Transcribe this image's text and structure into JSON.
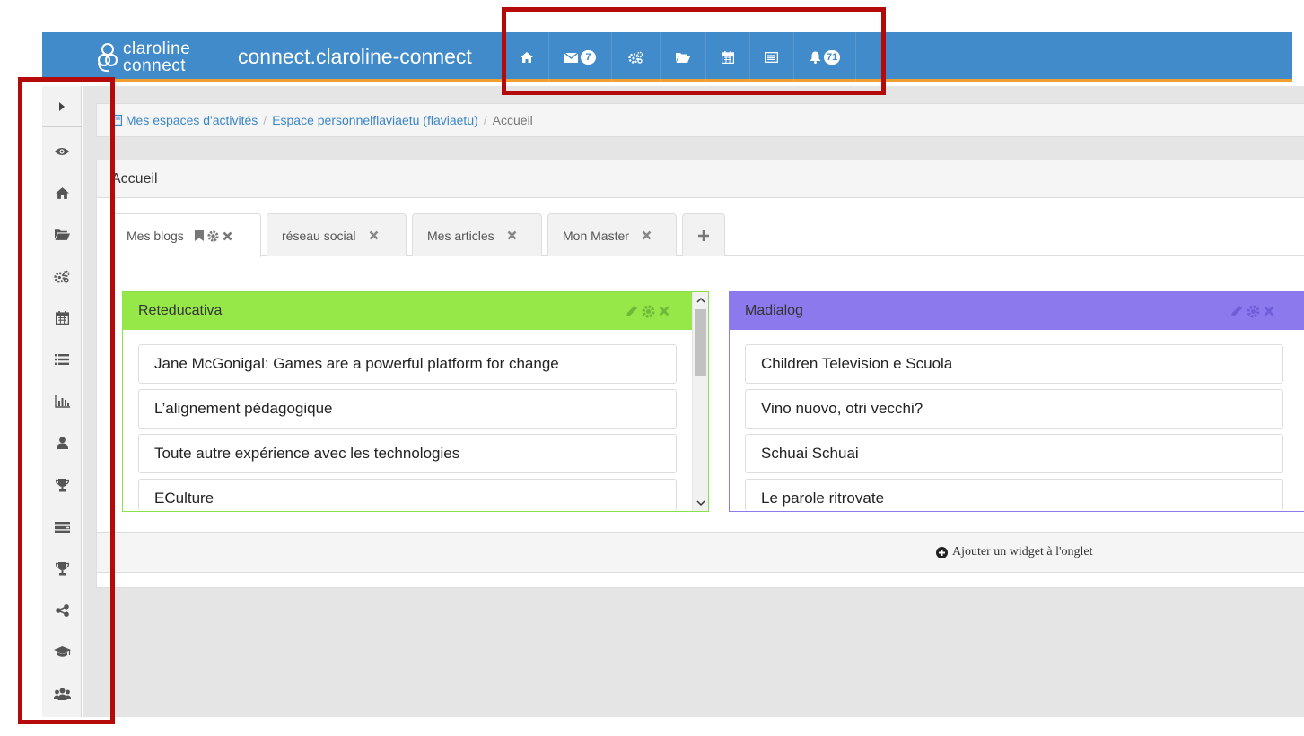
{
  "brand": {
    "logo_line1": "claroline",
    "logo_line2": "connect",
    "site_title": "connect.claroline-connect"
  },
  "topnav": [
    {
      "name": "home",
      "icon": "home-icon"
    },
    {
      "name": "messages",
      "icon": "envelope-icon",
      "badge": "7"
    },
    {
      "name": "tools",
      "icon": "cogs-icon"
    },
    {
      "name": "files",
      "icon": "folder-open-icon"
    },
    {
      "name": "agenda",
      "icon": "calendar-icon"
    },
    {
      "name": "desktop",
      "icon": "list-alt-icon"
    },
    {
      "name": "notifications",
      "icon": "bell-icon",
      "badge": "71"
    }
  ],
  "sidebar": [
    "caret-right-icon",
    "eye-icon",
    "home-icon",
    "folder-open-icon",
    "cogs-icon",
    "calendar-icon",
    "list-icon",
    "bar-chart-icon",
    "user-icon",
    "trophy-icon",
    "tasks-icon",
    "trophy-icon",
    "share-icon",
    "graduation-cap-icon",
    "users-icon"
  ],
  "breadcrumb": {
    "item1": "Mes espaces d'activités",
    "item2": "Espace personnelflaviaetu (flaviaetu)",
    "current": "Accueil"
  },
  "panel": {
    "title": "Accueil",
    "tabs": [
      "Mes blogs",
      "réseau social",
      "Mes articles",
      "Mon Master"
    ],
    "add_widget": "Ajouter un widget à l'onglet"
  },
  "widgets": [
    {
      "title": "Reteducativa",
      "color": "#96e849",
      "border": "#8ee04a",
      "items": [
        "Jane McGonigal: Games are a powerful platform for change",
        "L’alignement pédagogique",
        "Toute autre expérience avec les technologies",
        "ECulture"
      ]
    },
    {
      "title": "Madialog",
      "color": "#8d79ee",
      "border": "#8d79ee",
      "items": [
        "Children Television e Scuola",
        "Vino nuovo, otri vecchi?",
        "Schuai Schuai",
        "Le parole ritrovate"
      ]
    }
  ],
  "colors": {
    "topbar": "#428bca",
    "accent": "#f0a030",
    "highlight": "#b40a0a",
    "link": "#3a86c8"
  }
}
